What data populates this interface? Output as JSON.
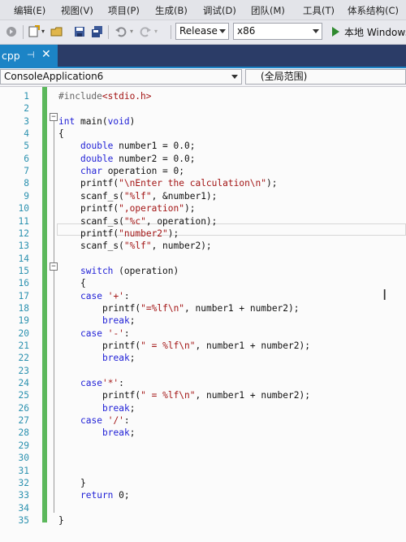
{
  "menu": {
    "items": [
      "编辑(E)",
      "视图(V)",
      "项目(P)",
      "生成(B)",
      "调试(D)",
      "团队(M)",
      "工具(T)",
      "体系结构(C)"
    ]
  },
  "toolbar": {
    "configuration": "Release",
    "platform": "x86",
    "run_label": "本地 Windows"
  },
  "tab": {
    "label": "cpp"
  },
  "navbar": {
    "project": "ConsoleApplication6",
    "scope": "(全局范围)"
  },
  "code": {
    "line_numbers": [
      "1",
      "2",
      "3",
      "4",
      "5",
      "6",
      "7",
      "8",
      "9",
      "10",
      "11",
      "12",
      "13",
      "14",
      "15",
      "16",
      "17",
      "18",
      "19",
      "20",
      "21",
      "22",
      "23",
      "24",
      "25",
      "26",
      "27",
      "28",
      "29",
      "30",
      "31",
      "32",
      "33",
      "34",
      "35"
    ],
    "lines": [
      "#include<stdio.h>",
      "",
      "int main(void)",
      "{",
      "double number1 = 0.0;",
      "double number2 = 0.0;",
      "char operation = 0;",
      "printf(\"\\nEnter the calculation\\n\");",
      "scanf_s(\"%lf\", &number1);",
      "printf(\",operation\");",
      "scanf_s(\"%c\", operation);",
      "printf(\"number2\");",
      "scanf_s(\"%lf\", number2);",
      "",
      "switch (operation)",
      "{",
      "case '+':",
      "printf(\"=%lf\\n\", number1 + number2);",
      "break;",
      "case '-':",
      "printf(\" = %lf\\n\", number1 + number2);",
      "break;",
      "",
      "case'*':",
      "printf(\" = %lf\\n\", number1 + number2);",
      "break;",
      "case '/':",
      "break;",
      "",
      "",
      "",
      "}",
      "return 0;",
      "",
      "}"
    ]
  }
}
